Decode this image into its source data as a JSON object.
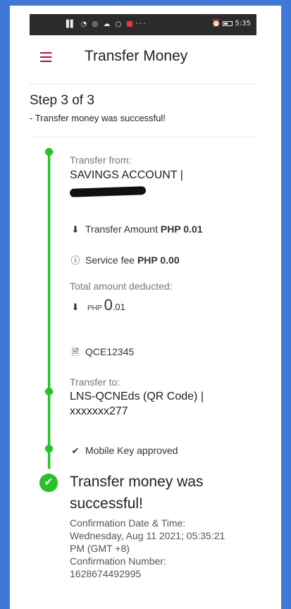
{
  "status_bar": {
    "left_icons": "..∥ ◎ Ω •••",
    "time": "5:35"
  },
  "header": {
    "title": "Transfer Money"
  },
  "step": {
    "title": "Step 3 of 3",
    "subtitle": "- Transfer money was successful!"
  },
  "transfer_from": {
    "label": "Transfer from:",
    "account": "SAVINGS ACCOUNT |"
  },
  "transfer_amount": {
    "label": "Transfer Amount",
    "value": "PHP 0.01"
  },
  "service_fee": {
    "label": "Service fee",
    "value": "PHP 0.00"
  },
  "total": {
    "label": "Total amount deducted:",
    "currency": "PHP",
    "whole": "0",
    "decimal": ".01"
  },
  "reference": "QCE12345",
  "transfer_to": {
    "label": "Transfer to:",
    "name": "LNS-QCNEds (QR Code) |",
    "account": "xxxxxxx277"
  },
  "mobile_key": "Mobile Key approved",
  "success": {
    "title_line1": "Transfer money was",
    "title_line2": "successful!",
    "date_label": "Confirmation Date & Time:",
    "date_line1": "Wednesday, Aug 11 2021; 05:35:21",
    "date_line2": "PM (GMT +8)",
    "number_label": "Confirmation Number:",
    "number": "1628674492995"
  },
  "colors": {
    "frame": "#3f79d8",
    "accent_red": "#c8102e",
    "timeline_green": "#27c227"
  }
}
